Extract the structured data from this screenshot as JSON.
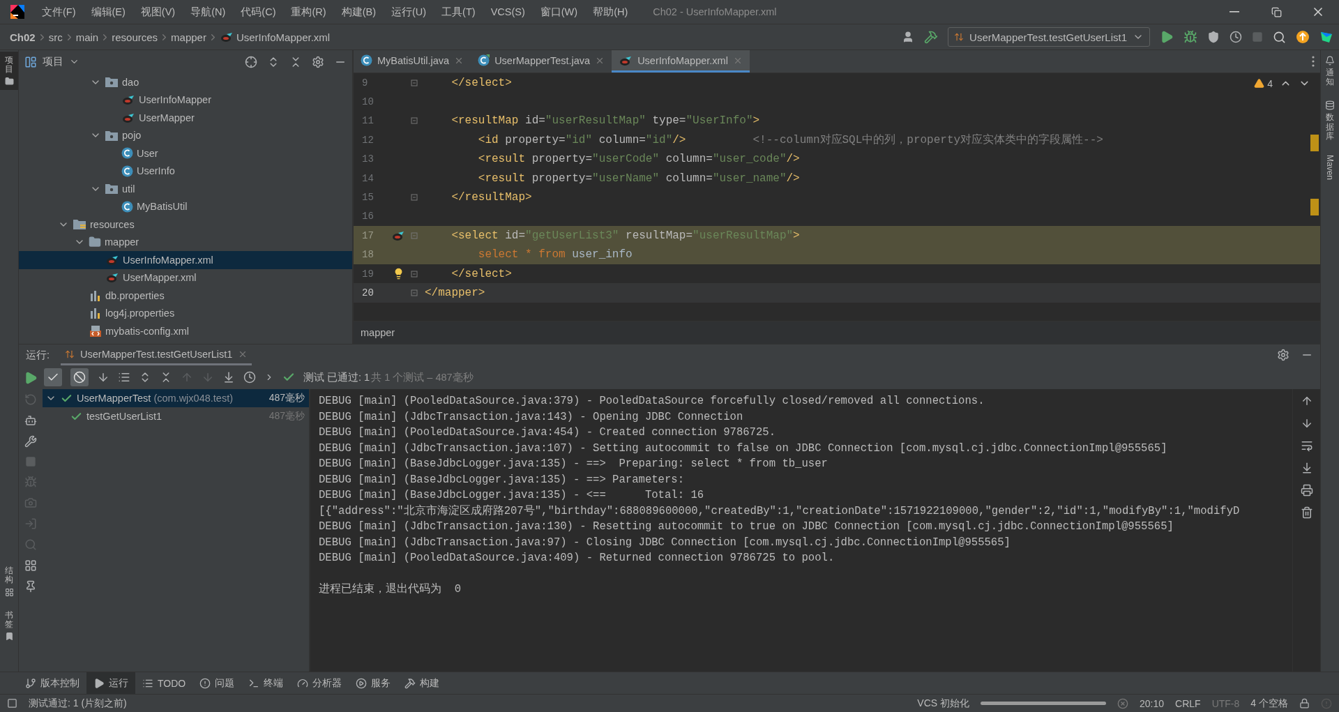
{
  "window": {
    "title": "Ch02 - UserInfoMapper.xml"
  },
  "menu": [
    "文件(F)",
    "编辑(E)",
    "视图(V)",
    "导航(N)",
    "代码(C)",
    "重构(R)",
    "构建(B)",
    "运行(U)",
    "工具(T)",
    "VCS(S)",
    "窗口(W)",
    "帮助(H)"
  ],
  "breadcrumb": [
    "Ch02",
    "src",
    "main",
    "resources",
    "mapper",
    "UserInfoMapper.xml"
  ],
  "run_config": {
    "label": "UserMapperTest.testGetUserList1"
  },
  "left_strip": [
    {
      "label": "项目",
      "selected": true
    },
    {
      "label": "结构",
      "selected": false
    },
    {
      "label": "书签",
      "selected": false
    }
  ],
  "right_strip": [
    {
      "label": "通知",
      "kind": "cjk"
    },
    {
      "label": "数据库",
      "kind": "cjk"
    },
    {
      "label": "Maven",
      "kind": "latin"
    }
  ],
  "project_panel": {
    "title": "项目",
    "tree": [
      {
        "kind": "group",
        "children": [
          {
            "kind": "group",
            "children": [
              {
                "label": "dao",
                "kind": "package",
                "expanded": true,
                "selected": false,
                "children": [
                  {
                    "label": "UserInfoMapper",
                    "kind": "mybatis",
                    "selected": false
                  },
                  {
                    "label": "UserMapper",
                    "kind": "mybatis",
                    "selected": false
                  }
                ]
              },
              {
                "label": "pojo",
                "kind": "package",
                "expanded": true,
                "selected": false,
                "children": [
                  {
                    "label": "User",
                    "kind": "class",
                    "selected": false
                  },
                  {
                    "label": "UserInfo",
                    "kind": "class",
                    "selected": false
                  }
                ]
              },
              {
                "label": "util",
                "kind": "package",
                "expanded": true,
                "selected": false,
                "children": [
                  {
                    "label": "MyBatisUtil",
                    "kind": "class",
                    "selected": false
                  }
                ]
              }
            ]
          }
        ]
      },
      {
        "label": "resources",
        "kind": "resources",
        "expanded": true,
        "selected": false,
        "children": [
          {
            "label": "mapper",
            "kind": "folder",
            "expanded": true,
            "selected": false,
            "children": [
              {
                "label": "UserInfoMapper.xml",
                "kind": "mybatis-xml",
                "selected": true
              },
              {
                "label": "UserMapper.xml",
                "kind": "mybatis-xml",
                "selected": false
              }
            ]
          },
          {
            "label": "db.properties",
            "kind": "properties",
            "selected": false
          },
          {
            "label": "log4j.properties",
            "kind": "properties",
            "selected": false
          },
          {
            "label": "mybatis-config.xml",
            "kind": "xml",
            "selected": false
          }
        ]
      }
    ]
  },
  "editor": {
    "tabs": [
      {
        "label": "MyBatisUtil.java",
        "kind": "class",
        "selected": false
      },
      {
        "label": "UserMapperTest.java",
        "kind": "test-class",
        "selected": false
      },
      {
        "label": "UserInfoMapper.xml",
        "kind": "mybatis-xml",
        "selected": true
      }
    ],
    "warnings": "4",
    "lines": [
      {
        "number": "9",
        "fold": true,
        "highlighted": false,
        "current": false,
        "tokens": [
          {
            "kind": "tag",
            "text": "    </select>"
          }
        ]
      },
      {
        "number": "10",
        "fold": false,
        "highlighted": false,
        "current": false
      },
      {
        "number": "11",
        "fold": true,
        "highlighted": false,
        "current": false,
        "tokens": [
          {
            "kind": "tag",
            "text": "    <resultMap"
          },
          {
            "kind": "attr",
            "text": " id="
          },
          {
            "kind": "str",
            "text": "\"userResultMap\""
          },
          {
            "kind": "attr",
            "text": " type="
          },
          {
            "kind": "str",
            "text": "\"UserInfo\""
          },
          {
            "kind": "tag",
            "text": ">"
          }
        ]
      },
      {
        "number": "12",
        "fold": false,
        "highlighted": false,
        "current": false,
        "tokens": [
          {
            "kind": "tag",
            "text": "        <id"
          },
          {
            "kind": "attr",
            "text": " property="
          },
          {
            "kind": "str",
            "text": "\"id\""
          },
          {
            "kind": "attr",
            "text": " column="
          },
          {
            "kind": "str",
            "text": "\"id\""
          },
          {
            "kind": "tag",
            "text": "/>"
          },
          {
            "kind": "comment",
            "text": "          <!--column对应SQL中的列，property对应实体类中的字段属性-->"
          }
        ]
      },
      {
        "number": "13",
        "fold": false,
        "highlighted": false,
        "current": false,
        "tokens": [
          {
            "kind": "tag",
            "text": "        <result"
          },
          {
            "kind": "attr",
            "text": " property="
          },
          {
            "kind": "str",
            "text": "\"userCode\""
          },
          {
            "kind": "attr",
            "text": " column="
          },
          {
            "kind": "str",
            "text": "\"user_code\""
          },
          {
            "kind": "tag",
            "text": "/>"
          }
        ]
      },
      {
        "number": "14",
        "fold": false,
        "highlighted": false,
        "current": false,
        "tokens": [
          {
            "kind": "tag",
            "text": "        <result"
          },
          {
            "kind": "attr",
            "text": " property="
          },
          {
            "kind": "str",
            "text": "\"userName\""
          },
          {
            "kind": "attr",
            "text": " column="
          },
          {
            "kind": "str",
            "text": "\"user_name\""
          },
          {
            "kind": "tag",
            "text": "/>"
          }
        ]
      },
      {
        "number": "15",
        "fold": true,
        "highlighted": false,
        "current": false,
        "tokens": [
          {
            "kind": "tag",
            "text": "    </resultMap>"
          }
        ]
      },
      {
        "number": "16",
        "fold": false,
        "highlighted": false,
        "current": false
      },
      {
        "number": "17",
        "fold": true,
        "highlighted": true,
        "current": false,
        "kind": "mybatis-gutter",
        "tokens": [
          {
            "kind": "tag",
            "text": "    <select"
          },
          {
            "kind": "attr",
            "text": " id="
          },
          {
            "kind": "str",
            "text": "\"getUserList3\""
          },
          {
            "kind": "attr",
            "text": " resultMap="
          },
          {
            "kind": "str",
            "text": "\"userResultMap\""
          },
          {
            "kind": "tag",
            "text": ">"
          }
        ]
      },
      {
        "number": "18",
        "fold": false,
        "highlighted": true,
        "current": false,
        "tokens": [
          {
            "kind": "keyword",
            "text": "        select * from"
          },
          {
            "kind": "plain",
            "text": " user_info"
          }
        ]
      },
      {
        "number": "19",
        "fold": true,
        "highlighted": false,
        "current": false,
        "kind": "bulb-gutter",
        "tokens": [
          {
            "kind": "tag",
            "text": "    </select>"
          }
        ]
      },
      {
        "number": "20",
        "fold": true,
        "highlighted": false,
        "current": true,
        "tokens": [
          {
            "kind": "tag",
            "text": "</mapper>"
          }
        ]
      }
    ],
    "breadcrumb": "mapper"
  },
  "run_panel": {
    "label": "运行:",
    "tab": "UserMapperTest.testGetUserList1",
    "show_passed": true,
    "show_ignored": true,
    "status": "测试 已通过: 1",
    "status_detail": "共 1 个测试 – 487毫秒",
    "tests": [
      {
        "label": "UserMapperTest",
        "package": "(com.wjx048.test)",
        "time": "487毫秒",
        "expanded": true,
        "selected": true,
        "children": [
          {
            "label": "testGetUserList1",
            "time": "487毫秒",
            "selected": false
          }
        ]
      }
    ],
    "console": [
      "DEBUG [main] (PooledDataSource.java:379) - PooledDataSource forcefully closed/removed all connections.",
      "DEBUG [main] (JdbcTransaction.java:143) - Opening JDBC Connection",
      "DEBUG [main] (PooledDataSource.java:454) - Created connection 9786725.",
      "DEBUG [main] (JdbcTransaction.java:107) - Setting autocommit to false on JDBC Connection [com.mysql.cj.jdbc.ConnectionImpl@955565]",
      "DEBUG [main] (BaseJdbcLogger.java:135) - ==>  Preparing: select * from tb_user",
      "DEBUG [main] (BaseJdbcLogger.java:135) - ==> Parameters:",
      "DEBUG [main] (BaseJdbcLogger.java:135) - <==      Total: 16",
      "[{\"address\":\"北京市海淀区成府路207号\",\"birthday\":688089600000,\"createdBy\":1,\"creationDate\":1571922109000,\"gender\":2,\"id\":1,\"modifyBy\":1,\"modifyD",
      "DEBUG [main] (JdbcTransaction.java:130) - Resetting autocommit to true on JDBC Connection [com.mysql.cj.jdbc.ConnectionImpl@955565]",
      "DEBUG [main] (JdbcTransaction.java:97) - Closing JDBC Connection [com.mysql.cj.jdbc.ConnectionImpl@955565]",
      "DEBUG [main] (PooledDataSource.java:409) - Returned connection 9786725 to pool."
    ],
    "exit_message": "进程已结束，退出代码为  0"
  },
  "tool_windows": [
    {
      "label": "版本控制",
      "kind": "vcs",
      "selected": false
    },
    {
      "label": "运行",
      "kind": "run",
      "selected": true
    },
    {
      "label": "TODO",
      "kind": "todo",
      "selected": false
    },
    {
      "label": "问题",
      "kind": "problems",
      "selected": false
    },
    {
      "label": "终端",
      "kind": "terminal",
      "selected": false
    },
    {
      "label": "分析器",
      "kind": "profiler",
      "selected": false
    },
    {
      "label": "服务",
      "kind": "services",
      "selected": false
    },
    {
      "label": "构建",
      "kind": "build",
      "selected": false
    }
  ],
  "status_bar": {
    "message": "测试通过: 1 (片刻之前)",
    "task": "VCS 初始化",
    "progress": {
      "level": 1
    },
    "position": "20:10",
    "line_separator": "CRLF",
    "encoding": "UTF-8",
    "indent": "4 个空格"
  }
}
